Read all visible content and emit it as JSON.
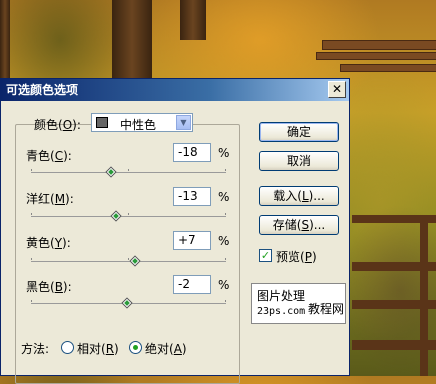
{
  "dialog": {
    "title": "可选颜色选项",
    "close_icon": "close-icon",
    "colors_label": "颜色(",
    "colors_key": "O",
    "colors_suffix": "):",
    "colors_value": "中性色",
    "sliders": [
      {
        "label": "青色(",
        "key": "C",
        "suffix": "):",
        "value": "-18",
        "unit": "%",
        "level": -18
      },
      {
        "label": "洋红(",
        "key": "M",
        "suffix": "):",
        "value": "-13",
        "unit": "%",
        "level": -13
      },
      {
        "label": "黄色(",
        "key": "Y",
        "suffix": "):",
        "value": "+7",
        "unit": "%",
        "level": 7
      },
      {
        "label": "黑色(",
        "key": "B",
        "suffix": "):",
        "value": "-2",
        "unit": "%",
        "level": -2
      }
    ],
    "buttons": {
      "ok": "确定",
      "cancel": "取消",
      "load": "载入(",
      "load_key": "L",
      "load_suffix": ")...",
      "save": "存储(",
      "save_key": "S",
      "save_suffix": ")..."
    },
    "preview": {
      "label": "预览(",
      "key": "P",
      "suffix": ")",
      "checked": true
    },
    "method": {
      "label": "方法:",
      "relative": "相对(",
      "relative_key": "R",
      "relative_suffix": ")",
      "absolute": "绝对(",
      "absolute_key": "A",
      "absolute_suffix": ")",
      "selected": "absolute"
    },
    "watermark": {
      "line1": "图片处理",
      "line2": "23ps.com",
      "line3": "教程网"
    }
  }
}
